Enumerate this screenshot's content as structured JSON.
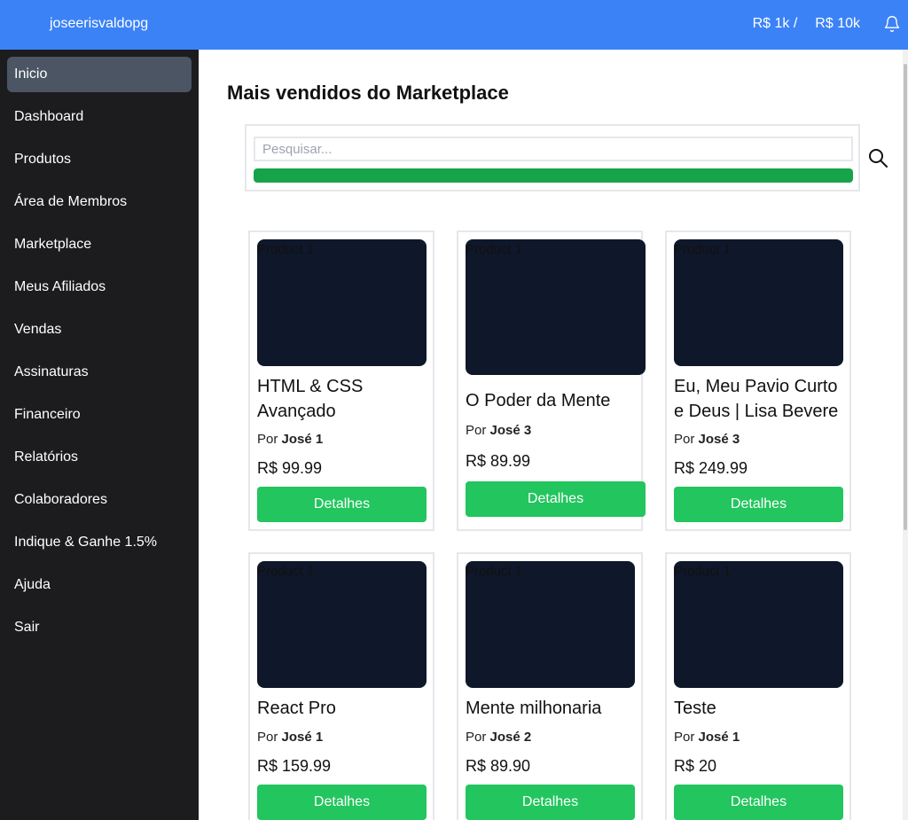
{
  "header": {
    "username": "joseerisvaldopg",
    "goal_current": "R$ 1k /",
    "goal_target": "R$ 10k",
    "bell_icon": "bell-icon"
  },
  "sidebar": {
    "items": [
      {
        "label": "Inicio",
        "active": true
      },
      {
        "label": "Dashboard"
      },
      {
        "label": "Produtos"
      },
      {
        "label": "Área de Membros"
      },
      {
        "label": "Marketplace"
      },
      {
        "label": "Meus Afiliados"
      },
      {
        "label": "Vendas"
      },
      {
        "label": "Assinaturas"
      },
      {
        "label": "Financeiro"
      },
      {
        "label": "Relatórios"
      },
      {
        "label": "Colaboradores"
      },
      {
        "label": "Indique & Ganhe 1.5%"
      },
      {
        "label": "Ajuda"
      },
      {
        "label": "Sair"
      }
    ]
  },
  "main": {
    "title": "Mais vendidos do Marketplace",
    "search": {
      "placeholder": "Pesquisar...",
      "value": "",
      "progress_percent": 100,
      "icon": "search-icon"
    },
    "products": [
      {
        "img_alt": "Product 1",
        "title_line1": "HTML & CSS",
        "title_line2": "Avançado",
        "author_prefix": "Por",
        "author": "José 1",
        "price": "R$ 99.99",
        "button": "Detalhes"
      },
      {
        "img_alt": "Product 1",
        "title_line1": "O Poder da Mente",
        "title_line2": "",
        "author_prefix": "Por",
        "author": "José 3",
        "price": "R$ 89.99",
        "button": "Detalhes"
      },
      {
        "img_alt": "Product 1",
        "title_line1": "Eu, Meu Pavio Curto",
        "title_line2": "e Deus | Lisa Bevere",
        "author_prefix": "Por",
        "author": "José 3",
        "price": "R$ 249.99",
        "button": "Detalhes"
      },
      {
        "img_alt": "Product 1",
        "title_line1": "React Pro",
        "title_line2": "",
        "author_prefix": "Por",
        "author": "José 1",
        "price": "R$ 159.99",
        "button": "Detalhes"
      },
      {
        "img_alt": "Product 1",
        "title_line1": "Mente milhonaria",
        "title_line2": "",
        "author_prefix": "Por",
        "author": "José 2",
        "price": "R$ 89.90",
        "button": "Detalhes"
      },
      {
        "img_alt": "Product 1",
        "title_line1": "Teste",
        "title_line2": "",
        "author_prefix": "Por",
        "author": "José 1",
        "price": "R$ 20",
        "button": "Detalhes"
      }
    ]
  },
  "colors": {
    "topbar": "#3b82f6",
    "sidebar": "#1c1c1f",
    "active_item": "#4b5563",
    "button": "#22c55e",
    "progress": "#16a34a",
    "image_placeholder": "#0f172a"
  }
}
